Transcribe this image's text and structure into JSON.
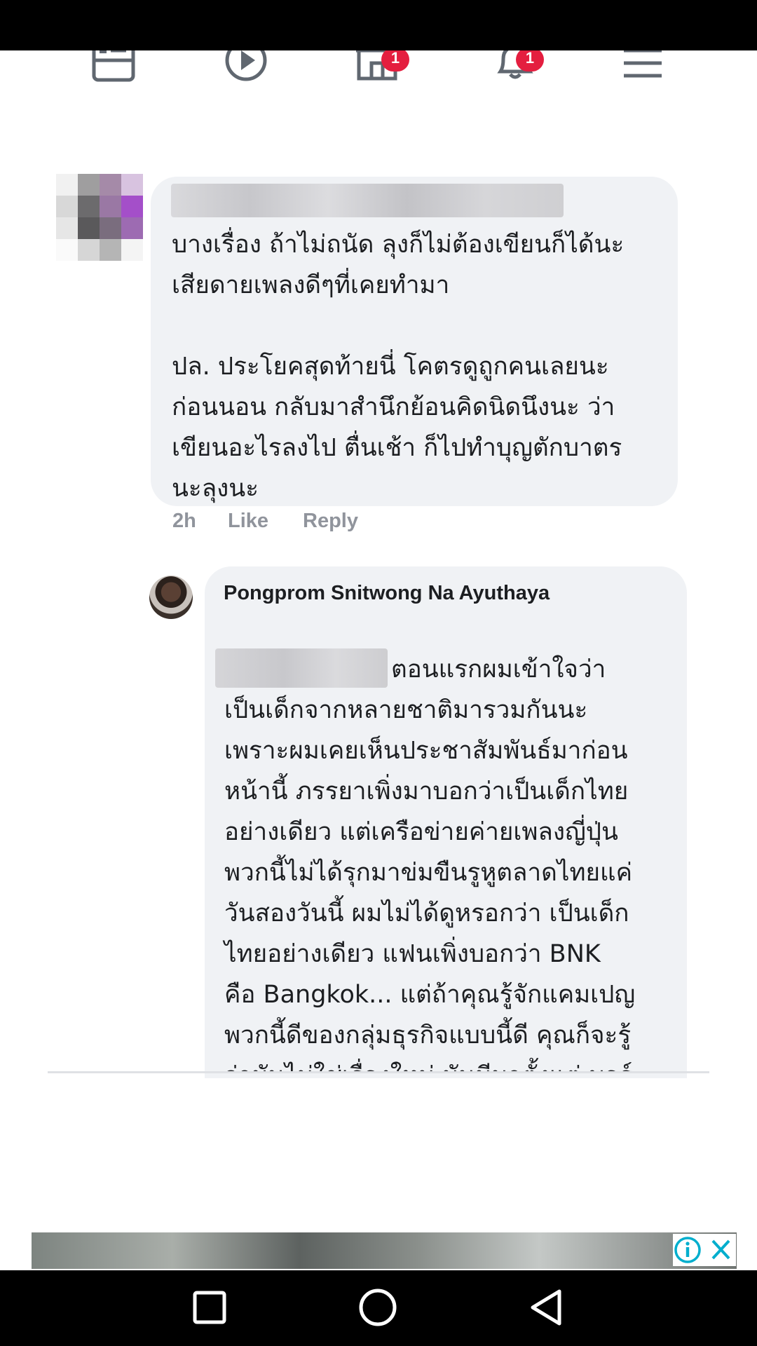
{
  "fb_nav": {
    "icons": [
      "feed-icon",
      "video-play-icon",
      "marketplace-icon",
      "notifications-bell-icon",
      "menu-icon"
    ],
    "marketplace_badge": "1",
    "notifications_badge": "1"
  },
  "comment1": {
    "text_lines": [
      "บางเรื่อง ถ้าไม่ถนัด ลุงก็ไม่ต้องเขียนก็ได้นะ",
      "เสียดายเพลงดีๆที่เคยทำมา",
      "",
      "ปล. ประโยคสุดท้ายนี่ โคตรดูถูกคนเลยนะ",
      "ก่อนนอน กลับมาสำนึกย้อนคิดนิดนึงนะ ว่า",
      "เขียนอะไรลงไป ตื่นเช้า ก็ไปทำบุญตักบาตร",
      "นะลุงนะ"
    ],
    "time": "2h",
    "like_label": "Like",
    "reply_label": "Reply"
  },
  "comment2": {
    "author": "Pongprom Snitwong Na Ayuthaya",
    "text_first_line": "ตอนแรกผมเข้าใจว่า",
    "text_lines": [
      "เป็นเด็กจากหลายชาติมารวมกันนะ",
      "เพราะผมเคยเห็นประชาสัมพันธ์มาก่อน",
      "หน้านี้ ภรรยาเพิ่งมาบอกว่าเป็นเด็กไทย",
      "อย่างเดียว แต่เครือข่ายค่ายเพลงญี่ปุ่น",
      "พวกนี้ไม่ได้รุกมาข่มขืนรูหูตลาดไทยแค่",
      "วันสองวันนี้ ผมไม่ได้ดูหรอกว่า เป็นเด็ก",
      "ไทยอย่างเดียว แฟนเพิ่งบอกว่า BNK",
      "คือ Bangkok... แต่ถ้าคุณรู้จักแคมเปญ",
      "พวกนี้ดีของกลุ่มธุรกิจแบบนี้ดี คุณก็จะรู้",
      "ว่ามันไม่ใช่เรื่องใหม่ มันมีมาตั้งแต่ บอร์"
    ]
  },
  "ad": {
    "info_icon": "info-icon",
    "close_icon": "close-icon"
  },
  "android_nav": [
    "recents-square-icon",
    "home-circle-icon",
    "back-triangle-icon"
  ]
}
